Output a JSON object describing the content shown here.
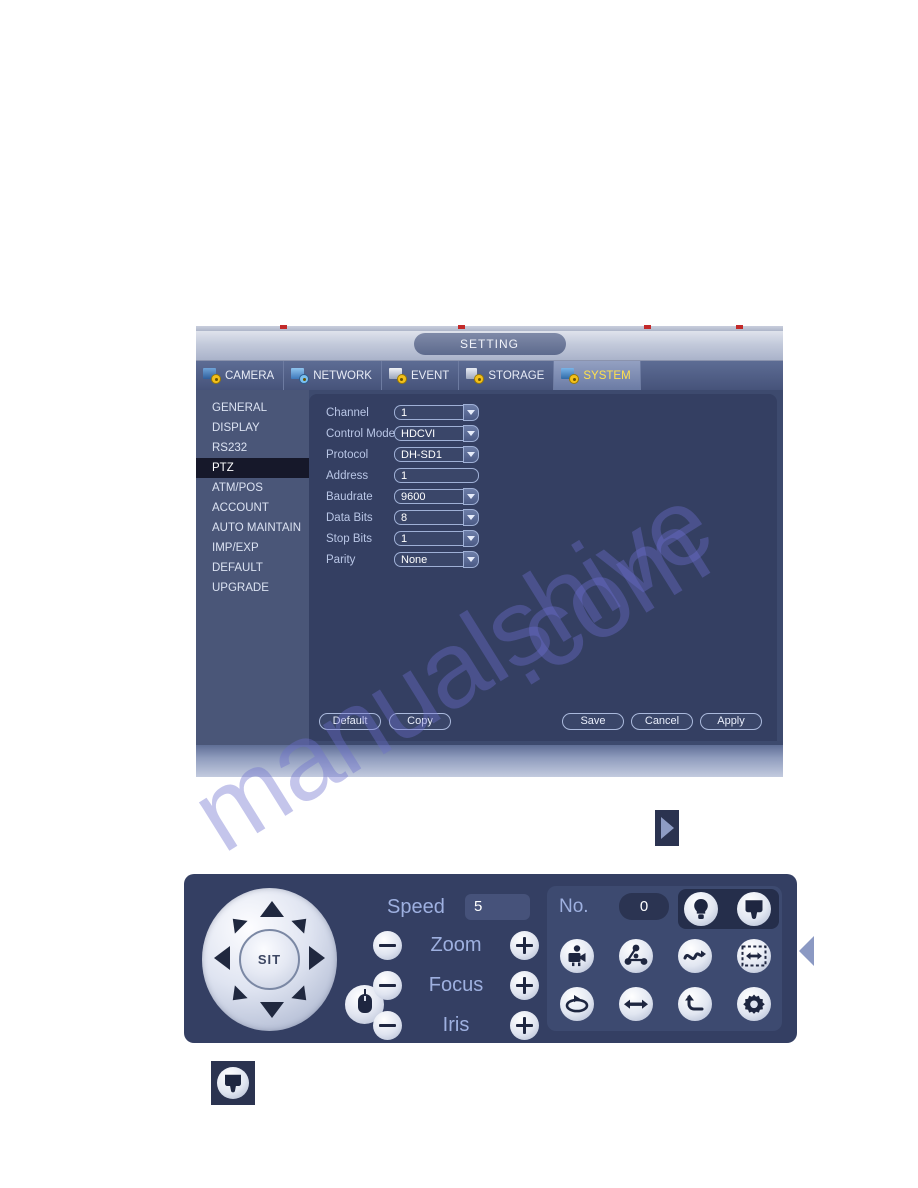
{
  "window": {
    "title": "SETTING",
    "tabs": [
      {
        "label": "CAMERA",
        "icon": "camera-icon",
        "active": false
      },
      {
        "label": "NETWORK",
        "icon": "network-icon",
        "active": false
      },
      {
        "label": "EVENT",
        "icon": "event-icon",
        "active": false
      },
      {
        "label": "STORAGE",
        "icon": "storage-icon",
        "active": false
      },
      {
        "label": "SYSTEM",
        "icon": "system-icon",
        "active": true
      }
    ]
  },
  "sidebar": {
    "items": [
      {
        "label": "GENERAL",
        "active": false
      },
      {
        "label": "DISPLAY",
        "active": false
      },
      {
        "label": "RS232",
        "active": false
      },
      {
        "label": "PTZ",
        "active": true
      },
      {
        "label": "ATM/POS",
        "active": false
      },
      {
        "label": "ACCOUNT",
        "active": false
      },
      {
        "label": "AUTO MAINTAIN",
        "active": false
      },
      {
        "label": "IMP/EXP",
        "active": false
      },
      {
        "label": "DEFAULT",
        "active": false
      },
      {
        "label": "UPGRADE",
        "active": false
      }
    ]
  },
  "form": {
    "fields": [
      {
        "label": "Channel",
        "value": "1",
        "dropdown": true
      },
      {
        "label": "Control Mode",
        "value": "HDCVI",
        "dropdown": true
      },
      {
        "label": "Protocol",
        "value": "DH-SD1",
        "dropdown": true
      },
      {
        "label": "Address",
        "value": "1",
        "dropdown": false
      },
      {
        "label": "Baudrate",
        "value": "9600",
        "dropdown": true
      },
      {
        "label": "Data Bits",
        "value": "8",
        "dropdown": true
      },
      {
        "label": "Stop Bits",
        "value": "1",
        "dropdown": true
      },
      {
        "label": "Parity",
        "value": "None",
        "dropdown": true
      }
    ],
    "buttons": {
      "default": "Default",
      "copy": "Copy",
      "save": "Save",
      "cancel": "Cancel",
      "apply": "Apply"
    }
  },
  "ptz": {
    "center_button": "SIT",
    "speed_label": "Speed",
    "speed_value": "5",
    "zoom_label": "Zoom",
    "focus_label": "Focus",
    "iris_label": "Iris",
    "no_label": "No.",
    "no_value": "0",
    "icons": [
      {
        "name": "light-icon",
        "row": 0,
        "col": 2
      },
      {
        "name": "wiper-icon",
        "row": 0,
        "col": 3
      },
      {
        "name": "preset-icon",
        "row": 1,
        "col": 0
      },
      {
        "name": "tour-icon",
        "row": 1,
        "col": 1
      },
      {
        "name": "pattern-icon",
        "row": 1,
        "col": 2
      },
      {
        "name": "auto-scan-icon",
        "row": 1,
        "col": 3
      },
      {
        "name": "rotate-icon",
        "row": 2,
        "col": 0
      },
      {
        "name": "flip-icon",
        "row": 2,
        "col": 1
      },
      {
        "name": "reset-icon",
        "row": 2,
        "col": 2
      },
      {
        "name": "aux-config-icon",
        "row": 2,
        "col": 3
      }
    ]
  },
  "watermark": {
    "line_a": "manualshive",
    "line_b": ".com"
  },
  "colors": {
    "window_bg": "#2e3a5c",
    "panel_bg": "#343f62",
    "sidebar_bg": "#4a5678",
    "active_item_bg": "#16182a",
    "active_tab_text": "#ffe14d",
    "label_text": "#b9c6e6",
    "ptz_accent": "#9eb0e0"
  }
}
